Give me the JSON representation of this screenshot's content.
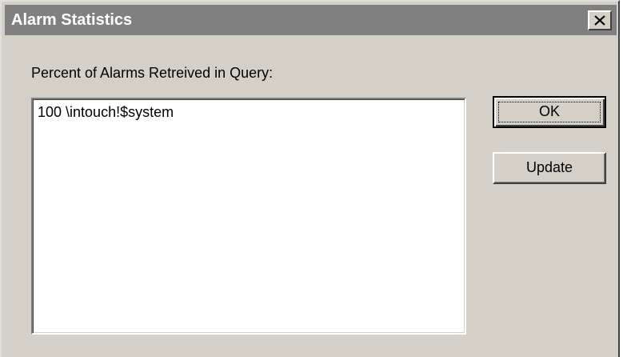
{
  "window": {
    "title": "Alarm Statistics",
    "close_icon": "close-x-icon"
  },
  "main": {
    "label": "Percent of Alarms Retreived in Query:",
    "list_items": [
      "100 \\intouch!$system"
    ]
  },
  "buttons": {
    "ok_label": "OK",
    "update_label": "Update"
  },
  "colors": {
    "dialog_bg": "#d4d0c8",
    "titlebar_bg": "#808080",
    "title_text": "#ffffff"
  }
}
